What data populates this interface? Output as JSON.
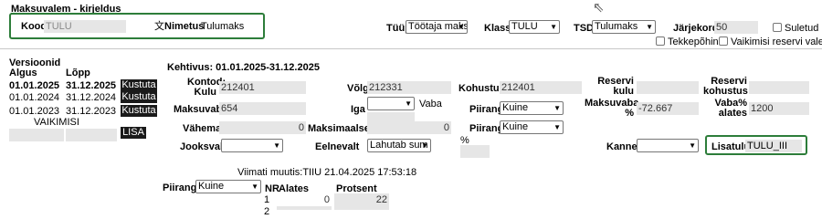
{
  "header": {
    "title": "Maksuvalem - kirjeldus",
    "kood_label": "Kood",
    "kood_value": "TULU",
    "nimetus_label": "Nimetus",
    "nimetus_value": "Tulumaks",
    "tuup_label": "Tüüp",
    "tuup_value": "Töötaja maks",
    "klass_label": "Klass",
    "klass_value": "TULU",
    "tsd_label": "TSD",
    "tsd_value": "Tulumaks",
    "jarjekord_label": "Järjekord",
    "jarjekord_value": "50",
    "suletud_label": "Suletud",
    "tekkepohine_label": "Tekkepõhine",
    "vaikimisi_reserv_label": "Vaikimisi reservi valem"
  },
  "versions": {
    "title": "Versioonid",
    "col_start": "Algus",
    "col_end": "Lõpp",
    "rows": [
      {
        "start": "01.01.2025",
        "end": "31.12.2025",
        "button": "Kustuta",
        "bold": true
      },
      {
        "start": "01.01.2024",
        "end": "31.12.2024",
        "button": "Kustuta",
        "bold": false
      },
      {
        "start": "01.01.2023",
        "end": "31.12.2023",
        "button": "Kustuta",
        "bold": false
      }
    ],
    "default_label": "VAIKIMISI",
    "add_button": "LISA"
  },
  "detail": {
    "validity": "Kehtivus: 01.01.2025-31.12.2025",
    "kontod_kulu_label": "Kontod: Kulu",
    "kontod_kulu_value": "212401",
    "volg_label": "Võlg",
    "volg_value": "212331",
    "kohustus_label": "Kohustus",
    "kohustus_value": "212401",
    "reservi_kulu_label": "Reservi kulu",
    "reservi_kulu_value": "",
    "reservi_kohustus_label": "Reservi kohustus",
    "reservi_kohustus_value": "",
    "maksuvaba_label": "Maksuvaba",
    "maksuvaba_value": "654",
    "iga_label": "Iga",
    "iga_value": "",
    "vaba_label": "Vaba",
    "piirang_label": "Piirang",
    "piirang_value": "Kuine",
    "maksuvaba_pct_label": "Maksuvaba %",
    "maksuvaba_pct_value": "-72.667",
    "vaba_pct_label": "Vaba% alates",
    "vaba_pct_value": "1200",
    "vahemalt_label": "Vähemalt",
    "vahemalt_value": "0",
    "maksimaalselt_label": "Maksimaalselt",
    "maksimaalselt_value": "0",
    "piirang2_label": "Piirang",
    "piirang2_value": "Kuine",
    "pct_sign": "%",
    "jooksvalt_label": "Jooksvalt",
    "jooksvalt_value": "",
    "eelnevalt_label": "Eelnevalt",
    "eelnevalt_value": "Lahutab sum",
    "kanne_label": "Kanne",
    "kanne_value": "",
    "lisatulu_label": "Lisatulu",
    "lisatulu_value": "TULU_III",
    "modified": "Viimati muutis:TIIU 21.04.2025 17:53:18"
  },
  "bottom": {
    "piirang_label": "Piirang",
    "piirang_value": "Kuine",
    "col_nr": "NR",
    "col_alates": "Alates",
    "col_protsent": "Protsent",
    "rows": [
      {
        "nr": "1",
        "alates": "0",
        "protsent": "22"
      },
      {
        "nr": "2",
        "alates": "",
        "protsent": ""
      }
    ]
  },
  "colors": {
    "highlight": "#2d7d3a",
    "field_bg": "#e6e6e6",
    "button_bg": "#1a1a1a"
  }
}
